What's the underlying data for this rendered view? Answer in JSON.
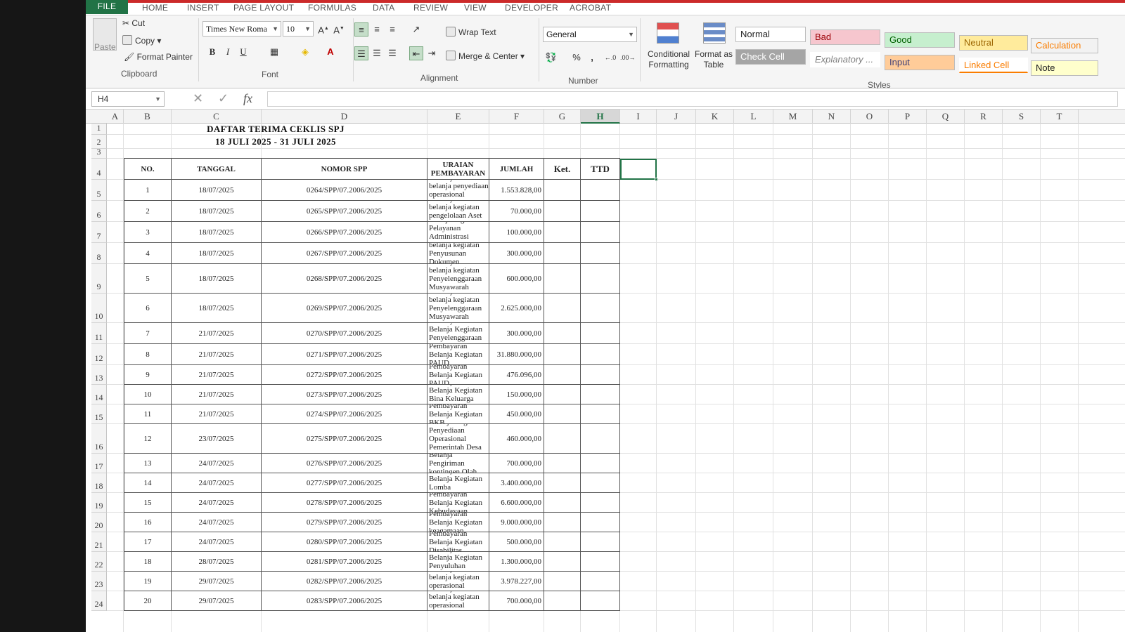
{
  "tabs": [
    "FILE",
    "HOME",
    "INSERT",
    "PAGE LAYOUT",
    "FORMULAS",
    "DATA",
    "REVIEW",
    "VIEW",
    "DEVELOPER",
    "ACROBAT"
  ],
  "clipboard": {
    "paste": "Paste",
    "cut": "Cut",
    "copy": "Copy",
    "format_painter": "Format Painter",
    "label": "Clipboard"
  },
  "font": {
    "name": "Times New Roma",
    "size": "10",
    "label": "Font",
    "bold": "B",
    "italic": "I",
    "underline": "U"
  },
  "alignment": {
    "wrap_text": "Wrap Text",
    "merge_center": "Merge & Center",
    "label": "Alignment"
  },
  "number": {
    "format": "General",
    "label": "Number",
    "percent": "%",
    "comma": ","
  },
  "styles_group": {
    "conditional_formatting": "Conditional Formatting",
    "format_as_table": "Format as Table",
    "label": "Styles",
    "cells": [
      {
        "name": "Normal",
        "bg": "#ffffff",
        "fg": "#222222"
      },
      {
        "name": "Bad",
        "bg": "#f6c6ce",
        "fg": "#9c0006"
      },
      {
        "name": "Good",
        "bg": "#c6efce",
        "fg": "#006100"
      },
      {
        "name": "Neutral",
        "bg": "#ffeb9c",
        "fg": "#9c6500"
      },
      {
        "name": "Calculation",
        "bg": "#f2f2f2",
        "fg": "#fa7d00"
      },
      {
        "name": "Check Cell",
        "bg": "#a5a5a5",
        "fg": "#ffffff"
      },
      {
        "name": "Explanatory ...",
        "bg": "#ffffff",
        "fg": "#7f7f7f"
      },
      {
        "name": "Input",
        "bg": "#ffcc99",
        "fg": "#3f3f76"
      },
      {
        "name": "Linked Cell",
        "bg": "#ffffff",
        "fg": "#fa7d00"
      },
      {
        "name": "Note",
        "bg": "#ffffcc",
        "fg": "#222222"
      }
    ]
  },
  "formula_bar": {
    "name_box": "H4",
    "fx": "fx",
    "value": ""
  },
  "columns": [
    "A",
    "B",
    "C",
    "D",
    "E",
    "F",
    "G",
    "H",
    "I",
    "J",
    "K",
    "L",
    "M",
    "N",
    "O",
    "P",
    "Q",
    "R",
    "S",
    "T"
  ],
  "active_column": "H",
  "sheet": {
    "title1": "DAFTAR TERIMA CEKLIS SPJ",
    "title2": "18 JULI 2025 - 31 JULI 2025",
    "headers": {
      "no": "NO.",
      "tanggal": "TANGGAL",
      "nomor_spp": "NOMOR SPP",
      "uraian": "URAIAN PEMBAYARAN",
      "jumlah": "JUMLAH",
      "ket": "Ket.",
      "ttd": "TTD"
    },
    "row_numbers": [
      "1",
      "2",
      "3",
      "4",
      "5",
      "6",
      "7",
      "8",
      "9",
      "10",
      "11",
      "12",
      "13",
      "14",
      "15",
      "16",
      "17",
      "18",
      "19",
      "20",
      "21",
      "22",
      "23",
      "24"
    ],
    "rows": [
      {
        "no": "1",
        "tanggal": "18/07/2025",
        "spp": "0264/SPP/07.2006/2025",
        "uraian": "Pembayaran belanja penyediaan operasional pemerintah desa",
        "jumlah": "1.553.828,00"
      },
      {
        "no": "2",
        "tanggal": "18/07/2025",
        "spp": "0265/SPP/07.2006/2025",
        "uraian": "Pembayaran belanja kegiatan pengelolaan Aset Desa",
        "jumlah": "70.000,00"
      },
      {
        "no": "3",
        "tanggal": "18/07/2025",
        "spp": "0266/SPP/07.2006/2025",
        "uraian": "Pembayaran belanja kegiatan Pelayanan Administrasi Umum dan Kependudukan",
        "jumlah": "100.000,00"
      },
      {
        "no": "4",
        "tanggal": "18/07/2025",
        "spp": "0267/SPP/07.2006/2025",
        "uraian": "Pembayaran belanja kegiatan Penyusunan Dokumen Keuangan Desa",
        "jumlah": "300.000,00"
      },
      {
        "no": "5",
        "tanggal": "18/07/2025",
        "spp": "0268/SPP/07.2006/2025",
        "uraian": "Pembayaran belanja kegiatan Penyelenggaraan Musyawarah Perencanaan Desa",
        "jumlah": "600.000,00"
      },
      {
        "no": "6",
        "tanggal": "18/07/2025",
        "spp": "0269/SPP/07.2006/2025",
        "uraian": "Pembayaran belanja kegiatan Penyelenggaraan Musyawarah Perencanaan Desa",
        "jumlah": "2.625.000,00"
      },
      {
        "no": "7",
        "tanggal": "21/07/2025",
        "spp": "0270/SPP/07.2006/2025",
        "uraian": "Penmayaran Belanja Kegiatan Penyelenggaraan Perpustakaan Desa",
        "jumlah": "300.000,00"
      },
      {
        "no": "8",
        "tanggal": "21/07/2025",
        "spp": "0271/SPP/07.2006/2025",
        "uraian": "Pembayaran Belanja Kegiatan PAUD",
        "jumlah": "31.880.000,00"
      },
      {
        "no": "9",
        "tanggal": "21/07/2025",
        "spp": "0272/SPP/07.2006/2025",
        "uraian": "Pembayaran Belanja Kegiatan PAUD",
        "jumlah": "476.096,00"
      },
      {
        "no": "10",
        "tanggal": "21/07/2025",
        "spp": "0273/SPP/07.2006/2025",
        "uraian": "Pembayaran Belanja Kegiatan Bina Keluarga Balita",
        "jumlah": "150.000,00"
      },
      {
        "no": "11",
        "tanggal": "21/07/2025",
        "spp": "0274/SPP/07.2006/2025",
        "uraian": "Pembayaran Belanja Kegiatan BKB",
        "jumlah": "450.000,00"
      },
      {
        "no": "12",
        "tanggal": "23/07/2025",
        "spp": "0275/SPP/07.2006/2025",
        "uraian": "Pembayaran Belanja Kegiatan Penyediaan Operasional Pemerintah Desa yang bersumber dari Dana Desa",
        "jumlah": "460.000,00"
      },
      {
        "no": "13",
        "tanggal": "24/07/2025",
        "spp": "0276/SPP/07.2006/2025",
        "uraian": "Pembayaran Belanja Pengiriman kontingen Olah Raga",
        "jumlah": "700.000,00"
      },
      {
        "no": "14",
        "tanggal": "24/07/2025",
        "spp": "0277/SPP/07.2006/2025",
        "uraian": "Pembayaran Belanja Kegiatan Lomba Kepamudaan",
        "jumlah": "3.400.000,00"
      },
      {
        "no": "15",
        "tanggal": "24/07/2025",
        "spp": "0278/SPP/07.2006/2025",
        "uraian": "Pembayaran Belanja Kegiatan Kebudayaan",
        "jumlah": "6.600.000,00"
      },
      {
        "no": "16",
        "tanggal": "24/07/2025",
        "spp": "0279/SPP/07.2006/2025",
        "uraian": "Pembayaran Belanja Kegiatan keagamaan",
        "jumlah": "9.000.000,00"
      },
      {
        "no": "17",
        "tanggal": "24/07/2025",
        "spp": "0280/SPP/07.2006/2025",
        "uraian": "Pembayaran Belanja Kegiatan Disabilitas",
        "jumlah": "500.000,00"
      },
      {
        "no": "18",
        "tanggal": "28/07/2025",
        "spp": "0281/SPP/07.2006/2025",
        "uraian": "Pembayaran Belanja Kegiatan Penyuluhan Kesehatan",
        "jumlah": "1.300.000,00"
      },
      {
        "no": "19",
        "tanggal": "29/07/2025",
        "spp": "0282/SPP/07.2006/2025",
        "uraian": "Pembayaran belanja kegiatan operasional pemerintah desa",
        "jumlah": "3.978.227,00"
      },
      {
        "no": "20",
        "tanggal": "29/07/2025",
        "spp": "0283/SPP/07.2006/2025",
        "uraian": "Pembayaran belanja kegiatan operasional pemerintah desa",
        "jumlah": "700.000,00"
      }
    ]
  }
}
